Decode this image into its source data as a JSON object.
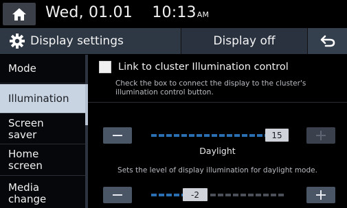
{
  "status_bar": {
    "date": "Wed, 01.01",
    "time": "10:13",
    "ampm": "AM"
  },
  "title_bar": {
    "title": "Display settings",
    "display_off_label": "Display off",
    "gear_icon": "gear-icon",
    "back_icon": "back-arrow-icon"
  },
  "sidebar": {
    "items": [
      {
        "label": "Mode"
      },
      {
        "label": "Illumination",
        "selected": true
      },
      {
        "label": "Screen\nsaver"
      },
      {
        "label": "Home\nscreen"
      },
      {
        "label": "Media\nchange"
      }
    ]
  },
  "content": {
    "link_checkbox_label": "Link to cluster Illumination control",
    "link_checkbox_checked": false,
    "link_description": "Check the box to connect the display to the cluster's illumination control button.",
    "daylight_slider": {
      "value": "15",
      "label": "Daylight",
      "fraction": 1.0
    },
    "slider_description": "Sets the level of display illumination for daylight mode.",
    "night_slider": {
      "value": "-2",
      "fraction": 0.45
    }
  },
  "colors": {
    "accent_blue": "#2b6fb3",
    "selected_item_bg": "#c9d4e3",
    "title_bar_bg": "#2e3744"
  }
}
